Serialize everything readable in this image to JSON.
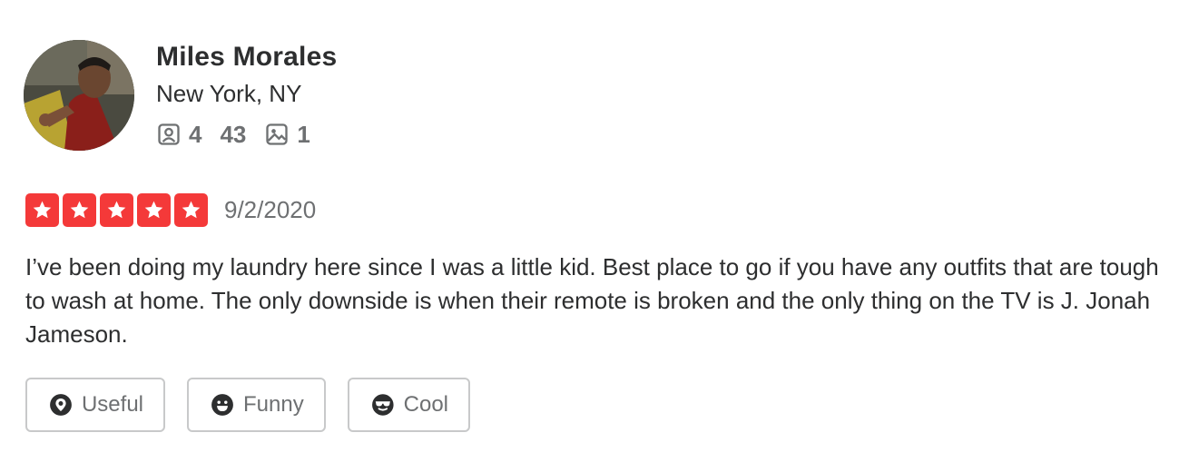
{
  "user": {
    "name": "Miles Morales",
    "location": "New York, NY",
    "stats": {
      "friends": "4",
      "reviews": "43",
      "photos": "1"
    }
  },
  "review": {
    "rating": 5,
    "date": "9/2/2020",
    "text": "I’ve been doing my laundry here since I was a little kid. Best place to go if you have any outfits that are tough to wash at home. The only downside is when their remote is broken and the only thing on the TV is J. Jonah Jameson."
  },
  "reactions": {
    "useful_label": "Useful",
    "funny_label": "Funny",
    "cool_label": "Cool"
  },
  "colors": {
    "star": "#f43939",
    "text": "#2d2e2f",
    "muted": "#6e7072",
    "border": "#c8c9ca"
  }
}
